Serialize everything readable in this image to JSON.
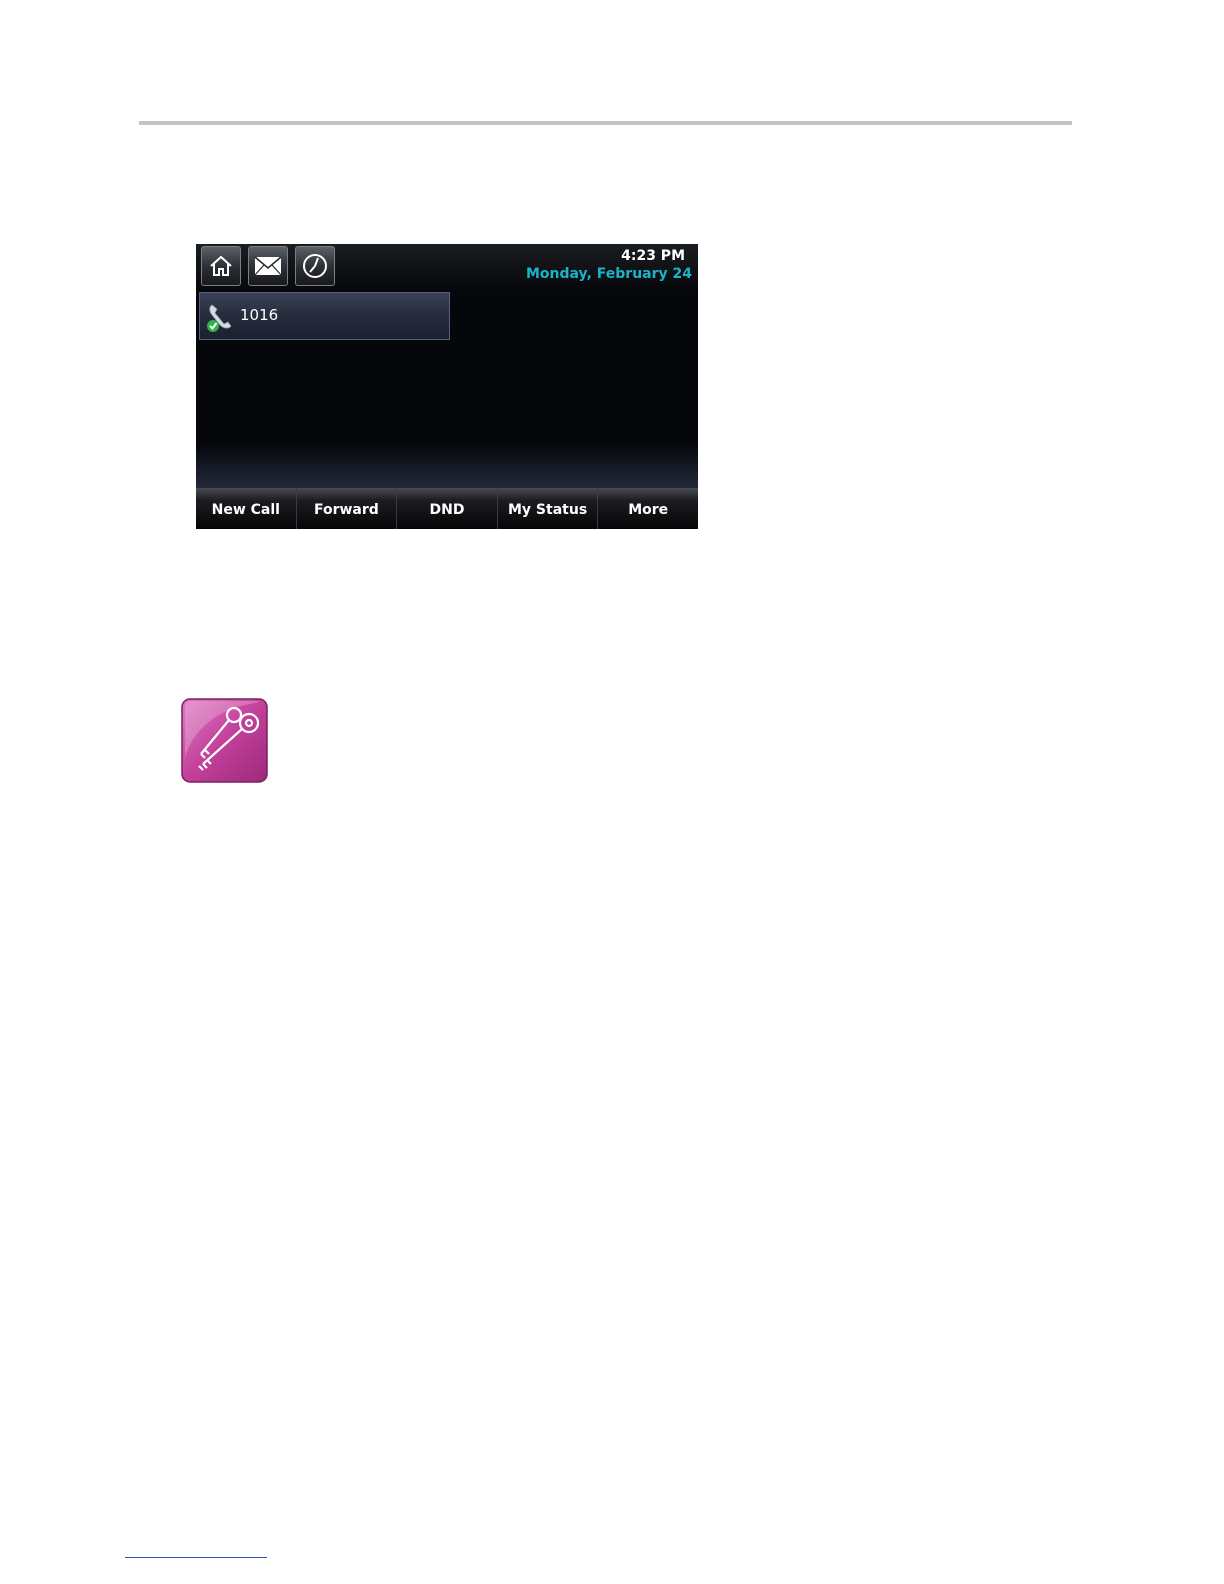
{
  "phone_screen": {
    "status_bar": {
      "time": "4:23 PM",
      "date": "Monday, February 24",
      "date_color": "#19b4c8",
      "icons": [
        "home-icon",
        "mail-icon",
        "clock-icon"
      ]
    },
    "line_key": {
      "label": "1016",
      "icon": "phone-registered-icon"
    },
    "softkeys": [
      "New Call",
      "Forward",
      "DND",
      "My Status",
      "More"
    ]
  },
  "note_icon": {
    "icon": "keys-icon",
    "color": "#c2409a"
  }
}
